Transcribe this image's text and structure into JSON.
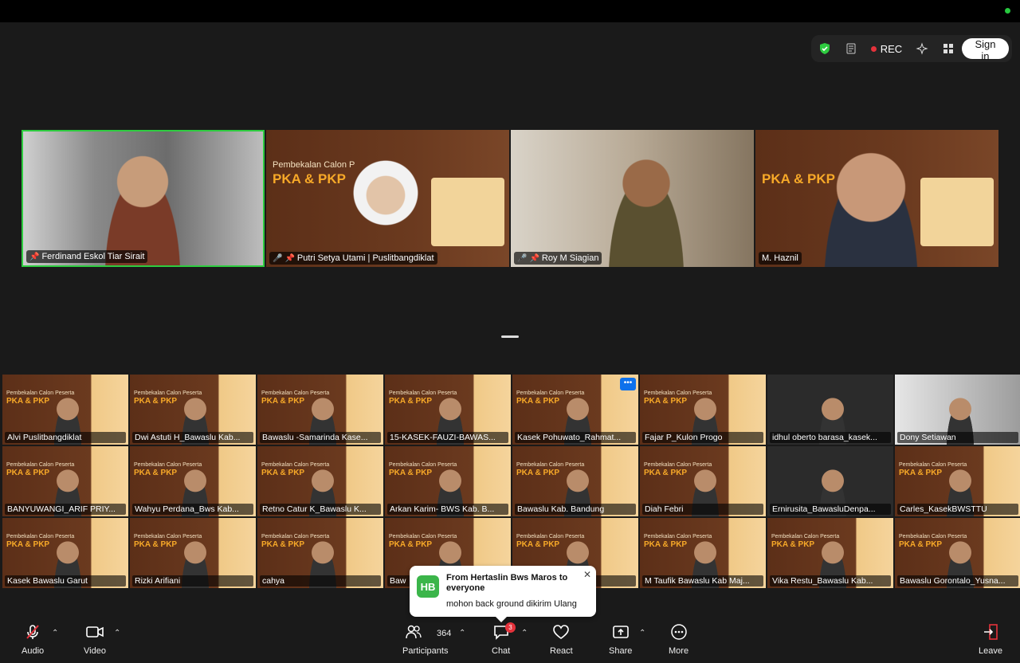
{
  "topbar": {
    "rec_label": "REC",
    "sign_in": "Sign in"
  },
  "speakers": [
    {
      "name": "Ferdinand Eskol Tiar Sirait",
      "muted": false
    },
    {
      "name": "Putri Setya Utami | Puslitbangdiklat",
      "muted": true
    },
    {
      "name": "Roy M Siagian",
      "muted": true
    },
    {
      "name": "M. Haznil",
      "muted": false
    }
  ],
  "slide": {
    "header": "Pembekalan Calon P",
    "title": "PKA & PKP"
  },
  "gallery_slide": {
    "header": "Pembekalan Calon Peserta",
    "title": "PKA & PKP"
  },
  "gallery": [
    "Alvi Puslitbangdiklat",
    "Dwi Astuti H_Bawaslu Kab...",
    "Bawaslu -Samarinda Kase...",
    "15-KASEK-FAUZI-BAWAS...",
    "Kasek Pohuwato_Rahmat...",
    "Fajar P_Kulon Progo",
    "idhul oberto barasa_kasek...",
    "Dony Setiawan",
    "BANYUWANGI_ARIF PRIY...",
    "Wahyu Perdana_Bws Kab...",
    "Retno Catur K_Bawaslu K...",
    "Arkan Karim- BWS Kab. B...",
    "Bawaslu Kab. Bandung",
    "Diah Febri",
    "Ernirusita_BawasluDenpa...",
    "Carles_KasekBWSTTU",
    "Kasek Bawaslu Garut",
    "Rizki Arifiani",
    "cahya",
    "Baw",
    "g-Puslit...",
    "M Taufik Bawaslu Kab Maj...",
    "Vika Restu_Bawaslu Kab...",
    "Bawaslu Gorontalo_Yusna..."
  ],
  "more_button": "•••",
  "toast": {
    "initials": "HB",
    "from": "From Hertaslin Bws Maros to everyone",
    "message": "mohon back ground dikirim Ulang"
  },
  "toolbar": {
    "audio": "Audio",
    "video": "Video",
    "participants": "Participants",
    "participants_count": "364",
    "chat": "Chat",
    "chat_badge": "3",
    "react": "React",
    "share": "Share",
    "more": "More",
    "leave": "Leave"
  }
}
